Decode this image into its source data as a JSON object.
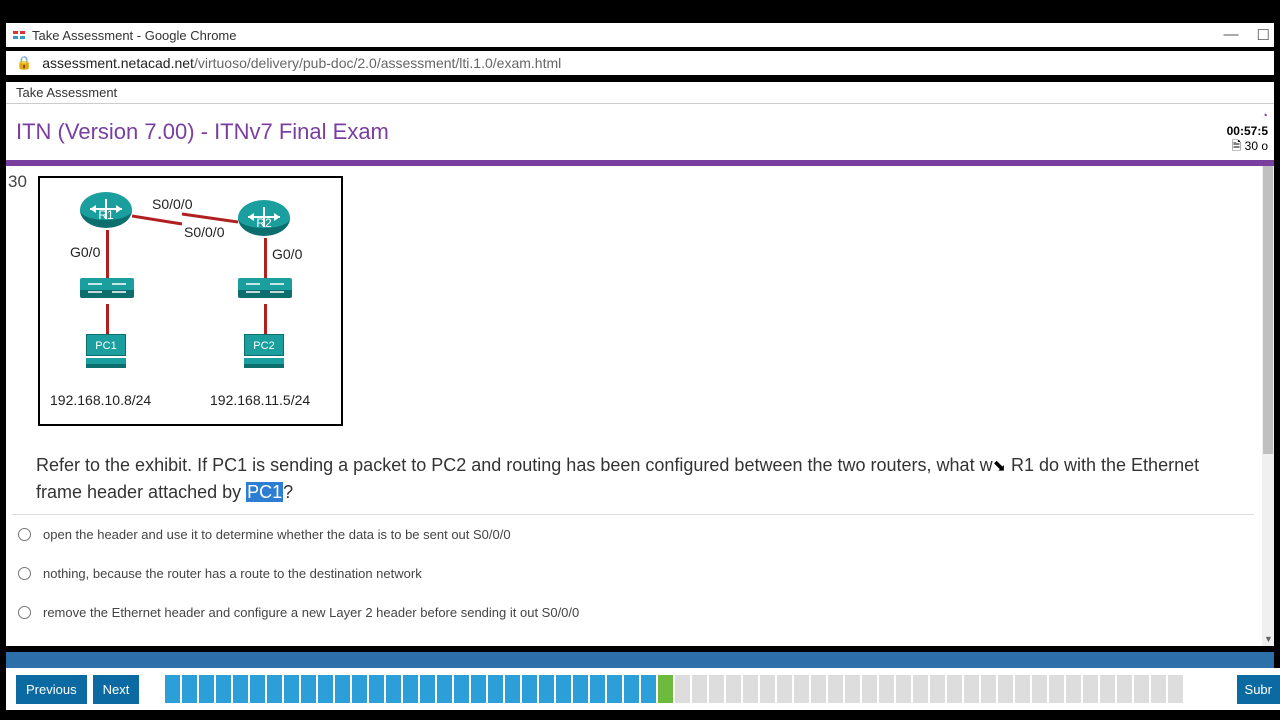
{
  "window": {
    "title": "Take Assessment - Google Chrome"
  },
  "address": {
    "domain": "assessment.netacad.net",
    "path": "/virtuoso/delivery/pub-doc/2.0/assessment/lti.1.0/exam.html"
  },
  "tab": {
    "label": "Take Assessment"
  },
  "exam": {
    "title": "ITN (Version 7.00) - ITNv7 Final Exam",
    "timer": "00:57:5",
    "remaining": "30 o"
  },
  "question": {
    "number": "30",
    "text_before": "Refer to the exhibit. If PC1 is sending a packet to PC2 and routing has been configured between the two routers, what w",
    "text_break": " R1 do with the Ethernet frame header attached by ",
    "highlight": "PC1",
    "text_after": "?"
  },
  "answers": [
    "open the header and use it to determine whether the data is to be sent out S0/0/0",
    "nothing, because the router has a route to the destination network",
    "remove the Ethernet header and configure a new Layer 2 header before sending it out S0/0/0"
  ],
  "exhibit": {
    "r1": "R1",
    "r2": "R2",
    "s000_a": "S0/0/0",
    "s000_b": "S0/0/0",
    "g00_a": "G0/0",
    "g00_b": "G0/0",
    "pc1": "PC1",
    "pc2": "PC2",
    "ip1": "192.168.10.8/24",
    "ip2": "192.168.11.5/24"
  },
  "footer": {
    "prev": "Previous",
    "next": "Next",
    "submit": "Subr"
  },
  "progress": {
    "done": 29,
    "current": 1,
    "remaining": 30
  }
}
